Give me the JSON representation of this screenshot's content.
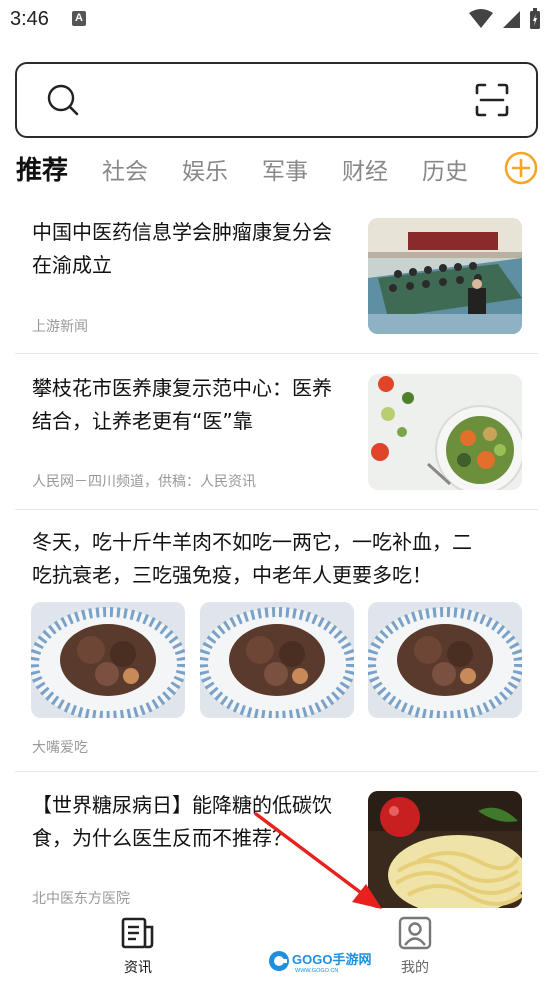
{
  "status_bar": {
    "time": "3:46",
    "notification_icon": "a-icon"
  },
  "search": {
    "placeholder": "",
    "search_icon": "search-icon",
    "scan_icon": "scan-icon"
  },
  "tabs": [
    {
      "label": "推荐",
      "active": true
    },
    {
      "label": "社会",
      "active": false
    },
    {
      "label": "娱乐",
      "active": false
    },
    {
      "label": "军事",
      "active": false
    },
    {
      "label": "财经",
      "active": false
    },
    {
      "label": "历史",
      "active": false
    }
  ],
  "articles": [
    {
      "title_line1": "中国中医药信息学会肿瘤康复分会",
      "title_line2": "在渝成立",
      "source": "上游新闻"
    },
    {
      "title_line1": "攀枝花市医养康复示范中心：医养",
      "title_line2": "结合，让养老更有“医”靠",
      "source": "人民网－四川频道，供稿：人民资讯"
    },
    {
      "title_line1": "冬天，吃十斤牛羊肉不如吃一两它，一吃补血，二",
      "title_line2": "吃抗衰老，三吃强免疫，中老年人更要多吃！",
      "source": "大嘴爱吃"
    },
    {
      "title_line1": "【世界糖尿病日】能降糖的低碳饮",
      "title_line2": "食，为什么医生反而不推荐？",
      "source": "北中医东方医院"
    }
  ],
  "bottom_nav": {
    "news_label": "资讯",
    "mine_label": "我的",
    "watermark_text": "GOGO手游网",
    "watermark_sub": "WWW.GOGO.CN"
  },
  "colors": {
    "accent": "#f5a623",
    "arrow": "#e8211e",
    "text_primary": "#111111",
    "text_secondary": "#999999",
    "tab_inactive": "#888888"
  }
}
